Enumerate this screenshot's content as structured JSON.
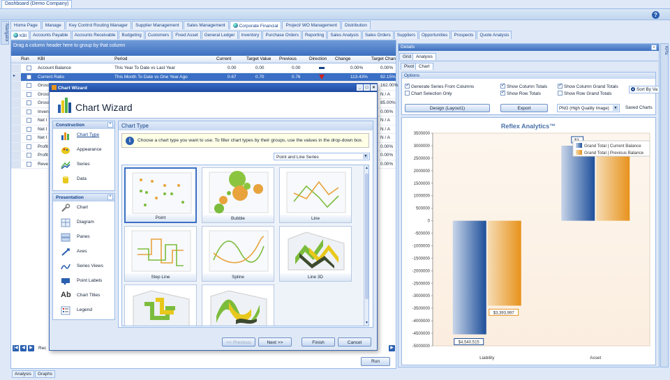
{
  "app": {
    "doc_tab": "Dashboard (Demo Company)",
    "help_icon": "?"
  },
  "side": {
    "left": "Navigator",
    "right": "KPIs"
  },
  "menu": [
    "Home Page",
    "Manage",
    "Key Control Routing Manager",
    "Supplier Management",
    "Sales Management",
    "Corporate Financial",
    "Project/ WO Management",
    "Distribution"
  ],
  "submenu": [
    "KBI",
    "Accounts Payable",
    "Accounts Receivable",
    "Budgeting",
    "Customers",
    "Fixed Asset",
    "General Ledger",
    "Inventory",
    "Purchase Orders",
    "Reporting",
    "Sales Analysis",
    "Sales Orders",
    "Suppliers",
    "Opportunities",
    "Prospects",
    "Quote Analysis"
  ],
  "grid": {
    "group_hint": "Drag a column header here to group by that column",
    "columns": [
      "Run",
      "KBI",
      "Period",
      "Current",
      "Target Value",
      "Previous",
      "Direction",
      "Change",
      "Target Chan"
    ],
    "rows": [
      {
        "kbi": "Account Balance",
        "period": "This Year To Date vs Last Year",
        "current": "0.00",
        "target": "0.00",
        "previous": "0.00",
        "change": "0.00%",
        "tchange": "0.00%"
      },
      {
        "kbi": "Current Ratio",
        "period": "This Month To Date vs One Year Ago",
        "current": "0.67",
        "target": "0.70",
        "previous": "0.76",
        "change": "113.43%",
        "tchange": "92.15%"
      },
      {
        "kbi": "Gross",
        "tchange": "162.00%"
      },
      {
        "kbi": "Gross",
        "tchange": "N / A"
      },
      {
        "kbi": "Gross",
        "tchange": "85.00%"
      },
      {
        "kbi": "Inven",
        "tchange": "0.00%"
      },
      {
        "kbi": "Net I",
        "tchange": "N / A"
      },
      {
        "kbi": "Net I",
        "tchange": "N / A"
      },
      {
        "kbi": "Net I",
        "tchange": "N / A"
      },
      {
        "kbi": "Profit",
        "tchange": "0.00%"
      },
      {
        "kbi": "Profit",
        "tchange": "0.00%"
      },
      {
        "kbi": "Reve",
        "tchange": "0.00%"
      }
    ],
    "record_label": "Rec",
    "run_label": "Run"
  },
  "bottom_tabs": [
    "Analysis",
    "Graphs"
  ],
  "wizard": {
    "title": "Chart Wizard",
    "heading": "Chart Wizard",
    "construction_title": "Construction",
    "construction": [
      "Chart Type",
      "Appearance",
      "Series",
      "Data"
    ],
    "presentation_title": "Presentation",
    "presentation": [
      "Chart",
      "Diagram",
      "Panes",
      "Axes",
      "Series Views",
      "Point Labels",
      "Chart Titles",
      "Legend"
    ],
    "page_title": "Chart Type",
    "info": "Choose a chart type you want to use. To filter chart types by their groups, use the values in the drop-down box.",
    "filter": "Point and Line Series",
    "tiles": [
      "Point",
      "Bubble",
      "Line",
      "Step Line",
      "Spline",
      "Line 3D",
      "",
      ""
    ],
    "buttons": {
      "previous": "<< Previous",
      "next": "Next >>",
      "finish": "Finish",
      "cancel": "Cancel"
    }
  },
  "details": {
    "title": "Details",
    "tabs": [
      "Grid",
      "Analysis"
    ],
    "subtabs": [
      "Pivot",
      "Chart"
    ],
    "options_title": "Options",
    "options": [
      "Generate Series From Columns",
      "Chart Selection Only",
      "Show Column Totals",
      "Show Row Totals",
      "Show Column Grand Totals",
      "Show Row Grand Totals",
      "Sort By Va"
    ],
    "design_button": "Design (Layout1)",
    "export_button": "Export",
    "format": "PNG (High Quality Image)",
    "saved_charts": "Saved Charts"
  },
  "chart_data": {
    "type": "bar",
    "title": "Reflex Analytics™",
    "categories": [
      "Liability",
      "Asset"
    ],
    "series": [
      {
        "name": "Grand Total | Current Balance",
        "values": [
          -4540515,
          3000000
        ]
      },
      {
        "name": "Grand Total | Previous Balance",
        "values": [
          -3393997,
          2570585
        ]
      }
    ],
    "data_labels": [
      "$4,540,515",
      "$3,393,997",
      "$3,",
      "$2,570,585"
    ],
    "yticks": [
      "3500000",
      "3000000",
      "2500000",
      "2000000",
      "1500000",
      "1000000",
      "500000",
      "0",
      "-500000",
      "-1000000",
      "-1500000",
      "-2000000",
      "-2500000",
      "-3000000",
      "-3500000",
      "-4000000",
      "-4500000",
      "-5000000"
    ],
    "ylim": [
      -5000000,
      3500000
    ],
    "legend": "top-right",
    "colors": [
      "#1d4f9a",
      "#e8921c"
    ]
  }
}
